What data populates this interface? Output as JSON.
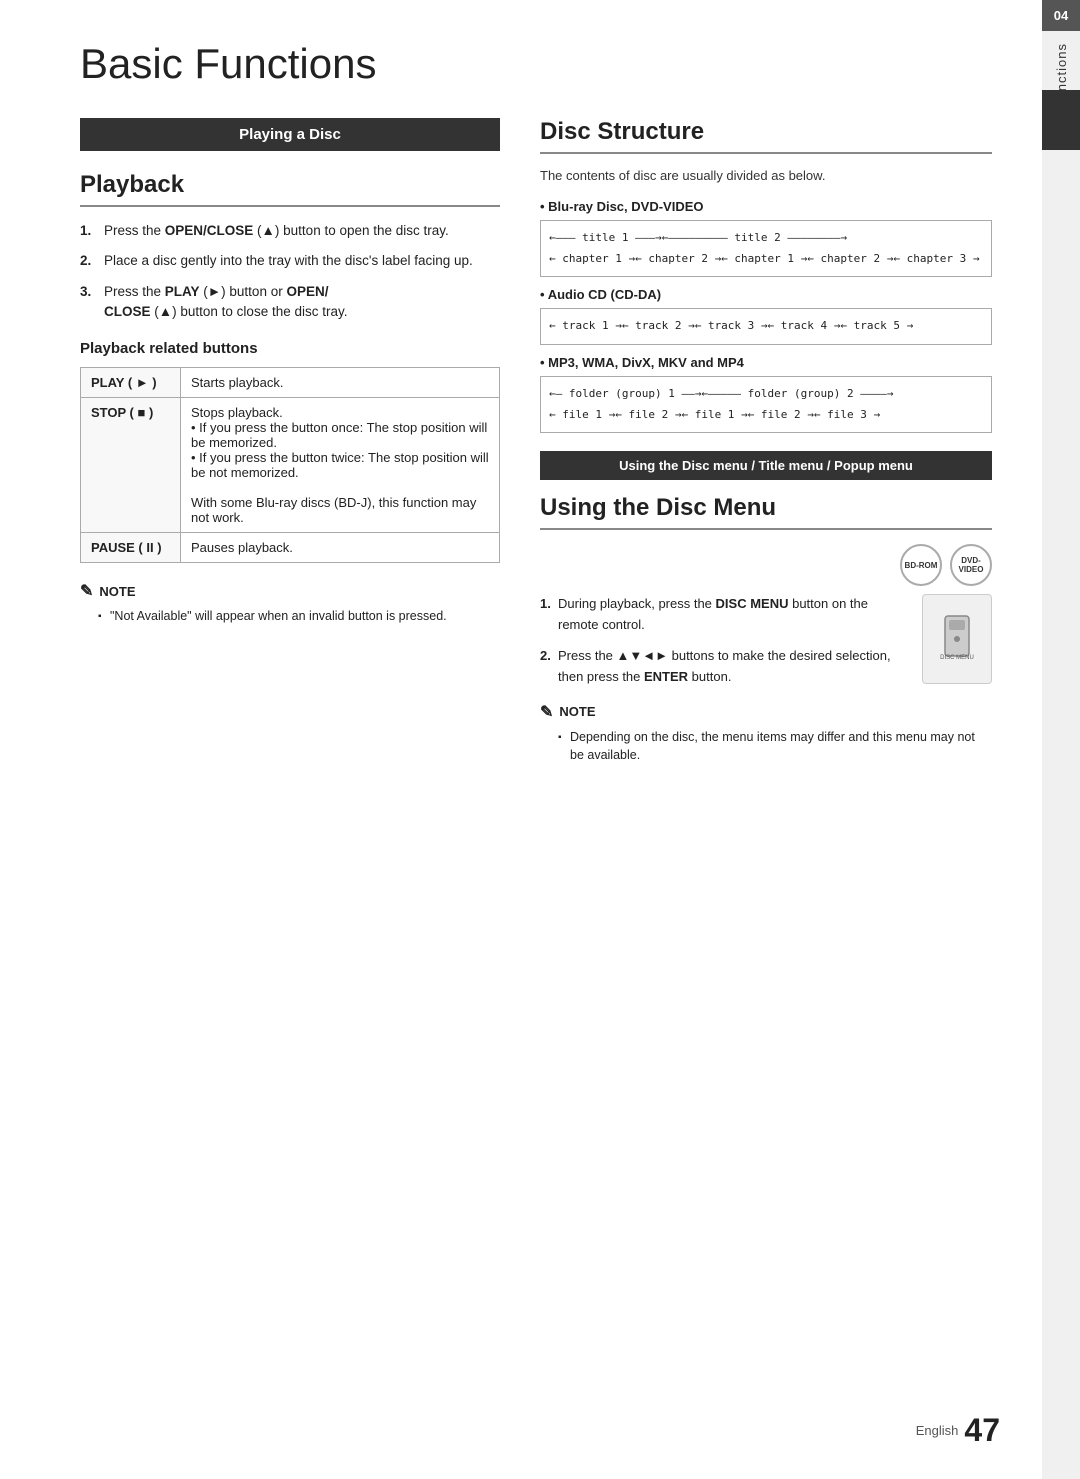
{
  "page": {
    "title": "Basic Functions",
    "side_tab_number": "04",
    "side_tab_label": "Basic Functions",
    "page_number": "47",
    "language": "English"
  },
  "left_col": {
    "banner": "Playing a Disc",
    "playback_heading": "Playback",
    "steps": [
      {
        "num": "1.",
        "text": "Press the OPEN/CLOSE (▲) button to open the disc tray."
      },
      {
        "num": "2.",
        "text": "Place a disc gently into the tray with the disc's label facing up."
      },
      {
        "num": "3.",
        "text": "Press the PLAY (►) button or OPEN/CLOSE (▲) button to close the disc tray."
      }
    ],
    "playback_buttons_heading": "Playback related buttons",
    "table_rows": [
      {
        "key": "PLAY ( ► )",
        "value": "Starts playback."
      },
      {
        "key": "STOP ( ■ )",
        "value_lines": [
          "Stops playback.",
          "• If you press the button once: The stop position will be memorized.",
          "• If you press the button twice: The stop position will be not memorized.",
          "With some Blu-ray discs (BD-J), this function may not work."
        ]
      },
      {
        "key": "PAUSE ( II )",
        "value": "Pauses playback."
      }
    ],
    "note_label": "NOTE",
    "note_items": [
      "\"Not Available\" will appear when an invalid button is pressed."
    ]
  },
  "right_col": {
    "disc_structure_heading": "Disc Structure",
    "disc_structure_desc": "The contents of disc are usually divided as below.",
    "disc_types": [
      {
        "label": "Blu-ray Disc, DVD-VIDEO",
        "diagram_lines": [
          "←——— title 1 ———→←————————— title 2 ————————→",
          "← chapter 1 →← chapter 2 →← chapter 1 →← chapter 2 →← chapter 3 →"
        ]
      },
      {
        "label": "Audio CD (CD-DA)",
        "diagram_lines": [
          "← track 1 →← track 2 →← track 3 →← track 4 →← track 5 →"
        ]
      },
      {
        "label": "MP3, WMA, DivX, MKV and MP4",
        "diagram_lines": [
          "←— folder (group) 1 ——→←————— folder (group) 2 ————→",
          "← file 1 →← file 2 →← file 1 →← file 2 →← file 3 →"
        ]
      }
    ],
    "disc_menu_banner": "Using the Disc menu / Title menu / Popup menu",
    "using_disc_menu_heading": "Using the Disc Menu",
    "disc_icon_labels": [
      "BD-ROM",
      "DVD-VIDEO"
    ],
    "using_disc_steps": [
      {
        "num": "1.",
        "text": "During playback, press the DISC MENU button on the remote control."
      },
      {
        "num": "2.",
        "text": "Press the ▲▼◄► buttons to make the desired selection, then press the ENTER button."
      }
    ],
    "note_label": "NOTE",
    "note_items": [
      "Depending on the disc, the menu items may differ and this menu may not be available."
    ],
    "remote_label": "DISC MENU"
  }
}
